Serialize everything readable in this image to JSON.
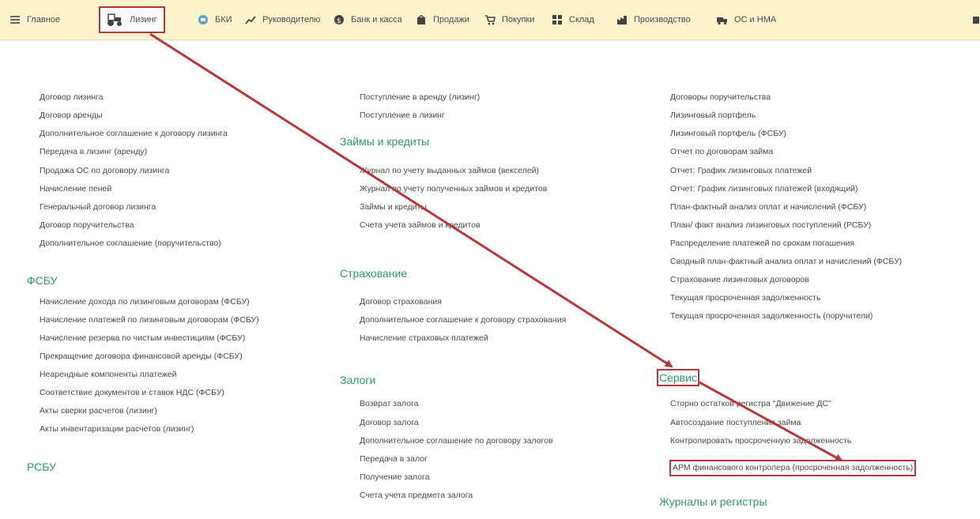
{
  "toolbar": {
    "items": [
      {
        "label": "Главное",
        "icon": "hamburger-menu-icon"
      },
      {
        "label": "Лизинг",
        "icon": "tractor-icon"
      },
      {
        "label": "БКИ",
        "icon": "bki-icon"
      },
      {
        "label": "Руководителю",
        "icon": "trend-chart-icon"
      },
      {
        "label": "Банк и касса",
        "icon": "bank-coin-icon"
      },
      {
        "label": "Продажи",
        "icon": "shopping-bag-icon"
      },
      {
        "label": "Покупки",
        "icon": "shopping-cart-icon"
      },
      {
        "label": "Склад",
        "icon": "warehouse-grid-icon"
      },
      {
        "label": "Производство",
        "icon": "factory-icon"
      },
      {
        "label": "ОС и НМА",
        "icon": "truck-icon"
      }
    ],
    "active": "Лизинг"
  },
  "column1": {
    "links": [
      "Договор лизинга",
      "Договор аренды",
      "Дополнительное соглашение к договору лизинга",
      "Передача в лизинг (аренду)",
      "Продажа ОС по договору лизинга",
      "Начисление пеней",
      "Генеральный договор лизинга",
      "Договор поручительства",
      "Дополнительное соглашение (поручительство)"
    ],
    "sections": [
      {
        "title": "ФСБУ",
        "links": [
          "Начисление дохода по лизинговым договорам (ФСБУ)",
          "Начисление платежей по лизинговым договорам (ФСБУ)",
          "Начисление резерва по чистым инвестициям (ФСБУ)",
          "Прекращение договора финансовой аренды (ФСБУ)",
          "Неарендные компоненты платежей",
          "Соответствие документов и ставок НДС (ФСБУ)",
          "Акты сверки расчетов (лизинг)",
          "Акты инвентаризации расчетов (лизинг)"
        ]
      },
      {
        "title": "РСБУ",
        "links": []
      }
    ]
  },
  "column2": {
    "links": [
      "Поступление в аренду (лизинг)",
      "Поступление в лизинг"
    ],
    "sections": [
      {
        "title": "Займы и кредиты",
        "links": [
          "Журнал по учету выданных займов (векселей)",
          "Журнал по учету полученных займов и кредитов",
          "Займы и кредиты",
          "Счета учета займов и кредитов"
        ]
      },
      {
        "title": "Страхование",
        "links": [
          "Договор страхования",
          "Дополнительное соглашение к договору страхования",
          "Начисление страховых платежей"
        ]
      },
      {
        "title": "Залоги",
        "links": [
          "Возврат залога",
          "Договор залога",
          "Дополнительное соглашение по договору залогов",
          "Передача в залог",
          "Получение залога",
          "Счета учета предмета залога"
        ]
      }
    ]
  },
  "column3": {
    "links": [
      "Договоры поручительства",
      "Лизинговый портфель",
      "Лизинговый портфель (ФСБУ)",
      "Отчет по договорам займа",
      "Отчет: График лизинговых платежей",
      "Отчет: График лизинговых платежей (входящий)",
      "План-фактный анализ оплат и начислений (ФСБУ)",
      "План/ факт анализ лизинговых поступлений (РСБУ)",
      "Распределение платежей по срокам погашения",
      "Сводный план-фактный анализ оплат и начислений (ФСБУ)",
      "Страхование лизинговых договоров",
      "Текущая просроченная задолженность",
      "Текущая просроченная задолженность (поручители)"
    ],
    "sections": [
      {
        "title": "Сервис",
        "links": [
          "Сторно остатков регистра \"Движение ДС\"",
          "Автосоздание поступления займа",
          "Контролировать просроченную задолженность",
          "АРМ финансового контролера (просроченная задолженность)"
        ]
      },
      {
        "title": "Журналы и регистры",
        "links": []
      }
    ]
  },
  "colors": {
    "toolbar_bg": "#fbf3cc",
    "section_green": "#2e9b6a",
    "highlight_red": "#b9373b"
  }
}
